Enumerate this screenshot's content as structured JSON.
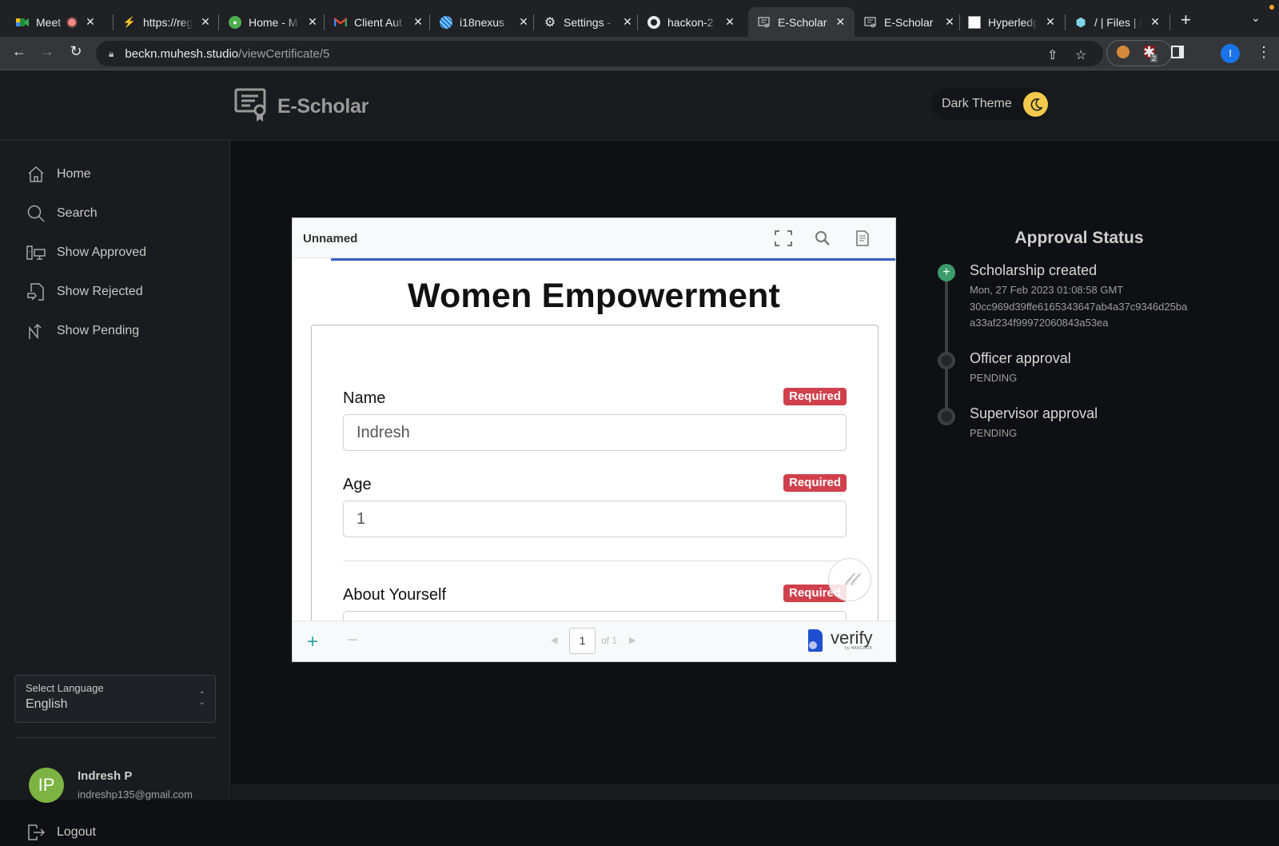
{
  "browser": {
    "tabs": [
      {
        "title": "Meet",
        "icon": "google-meet-icon",
        "recording": true,
        "active": false
      },
      {
        "title": "https://reg",
        "icon": "lightning-icon",
        "active": false
      },
      {
        "title": "Home - M",
        "icon": "mongodb-leaf-icon",
        "active": false
      },
      {
        "title": "Client Aut",
        "icon": "gmail-icon",
        "active": false
      },
      {
        "title": "i18nexus",
        "icon": "i18nexus-icon",
        "active": false
      },
      {
        "title": "Settings -",
        "icon": "gear-icon",
        "active": false
      },
      {
        "title": "hackon-2",
        "icon": "github-icon",
        "active": false
      },
      {
        "title": "E-Scholar",
        "icon": "certificate-icon",
        "active": true
      },
      {
        "title": "E-Scholar",
        "icon": "certificate-icon",
        "active": false
      },
      {
        "title": "Hyperledg",
        "icon": "hyperledger-icon",
        "active": false
      },
      {
        "title": "/ | Files | I",
        "icon": "cube-icon",
        "active": false
      }
    ],
    "url_host": "beckn.muhesh.studio",
    "url_path": "/viewCertificate/5",
    "extension_badge": "2",
    "profile_initial": "I"
  },
  "header": {
    "app_name": "E-Scholar",
    "theme_toggle_label": "Dark Theme"
  },
  "sidebar": {
    "items": [
      {
        "label": "Home",
        "icon": "home-icon"
      },
      {
        "label": "Search",
        "icon": "search-icon"
      },
      {
        "label": "Show Approved",
        "icon": "devices-icon"
      },
      {
        "label": "Show Rejected",
        "icon": "document-thumbs-down-icon"
      },
      {
        "label": "Show Pending",
        "icon": "trending-arrow-icon"
      }
    ],
    "language": {
      "label": "Select Language",
      "value": "English"
    },
    "user": {
      "initials": "IP",
      "name": "Indresh P",
      "email": "indreshp135@gmail.com"
    },
    "logout_label": "Logout"
  },
  "viewer": {
    "doc_name": "Unnamed",
    "doc_title": "Women Empowerment",
    "fields": [
      {
        "label": "Name",
        "value": "Indresh",
        "badge": "Required"
      },
      {
        "label": "Age",
        "value": "1",
        "badge": "Required"
      },
      {
        "label": "About Yourself",
        "value": "",
        "badge": "Required"
      }
    ],
    "page_current": "1",
    "page_total_label": "of 1",
    "load_progress_percent": 100,
    "brand": "verify",
    "brand_sub": "by HANCOCK"
  },
  "approval": {
    "title": "Approval Status",
    "steps": [
      {
        "title": "Scholarship created",
        "status": "done",
        "lines": [
          "Mon, 27 Feb 2023 01:08:58 GMT",
          "30cc969d39ffe6165343647ab4a37c9346d25ba",
          "a33af234f99972060843a53ea"
        ]
      },
      {
        "title": "Officer approval",
        "status": "pending",
        "lines": [
          "PENDING"
        ]
      },
      {
        "title": "Supervisor approval",
        "status": "pending",
        "lines": [
          "PENDING"
        ]
      }
    ]
  },
  "colors": {
    "accent_yellow": "#f2c94c",
    "required_red": "#d0404c",
    "success_green": "#3c9b6a",
    "avatar_green": "#7cb342",
    "progress_blue": "#3b5fc0"
  }
}
